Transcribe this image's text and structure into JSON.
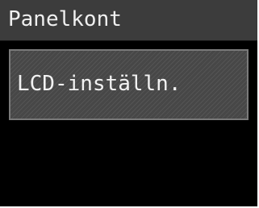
{
  "header": {
    "title": "Panelkont"
  },
  "menu": {
    "items": [
      {
        "label": "LCD-inställn."
      }
    ]
  }
}
